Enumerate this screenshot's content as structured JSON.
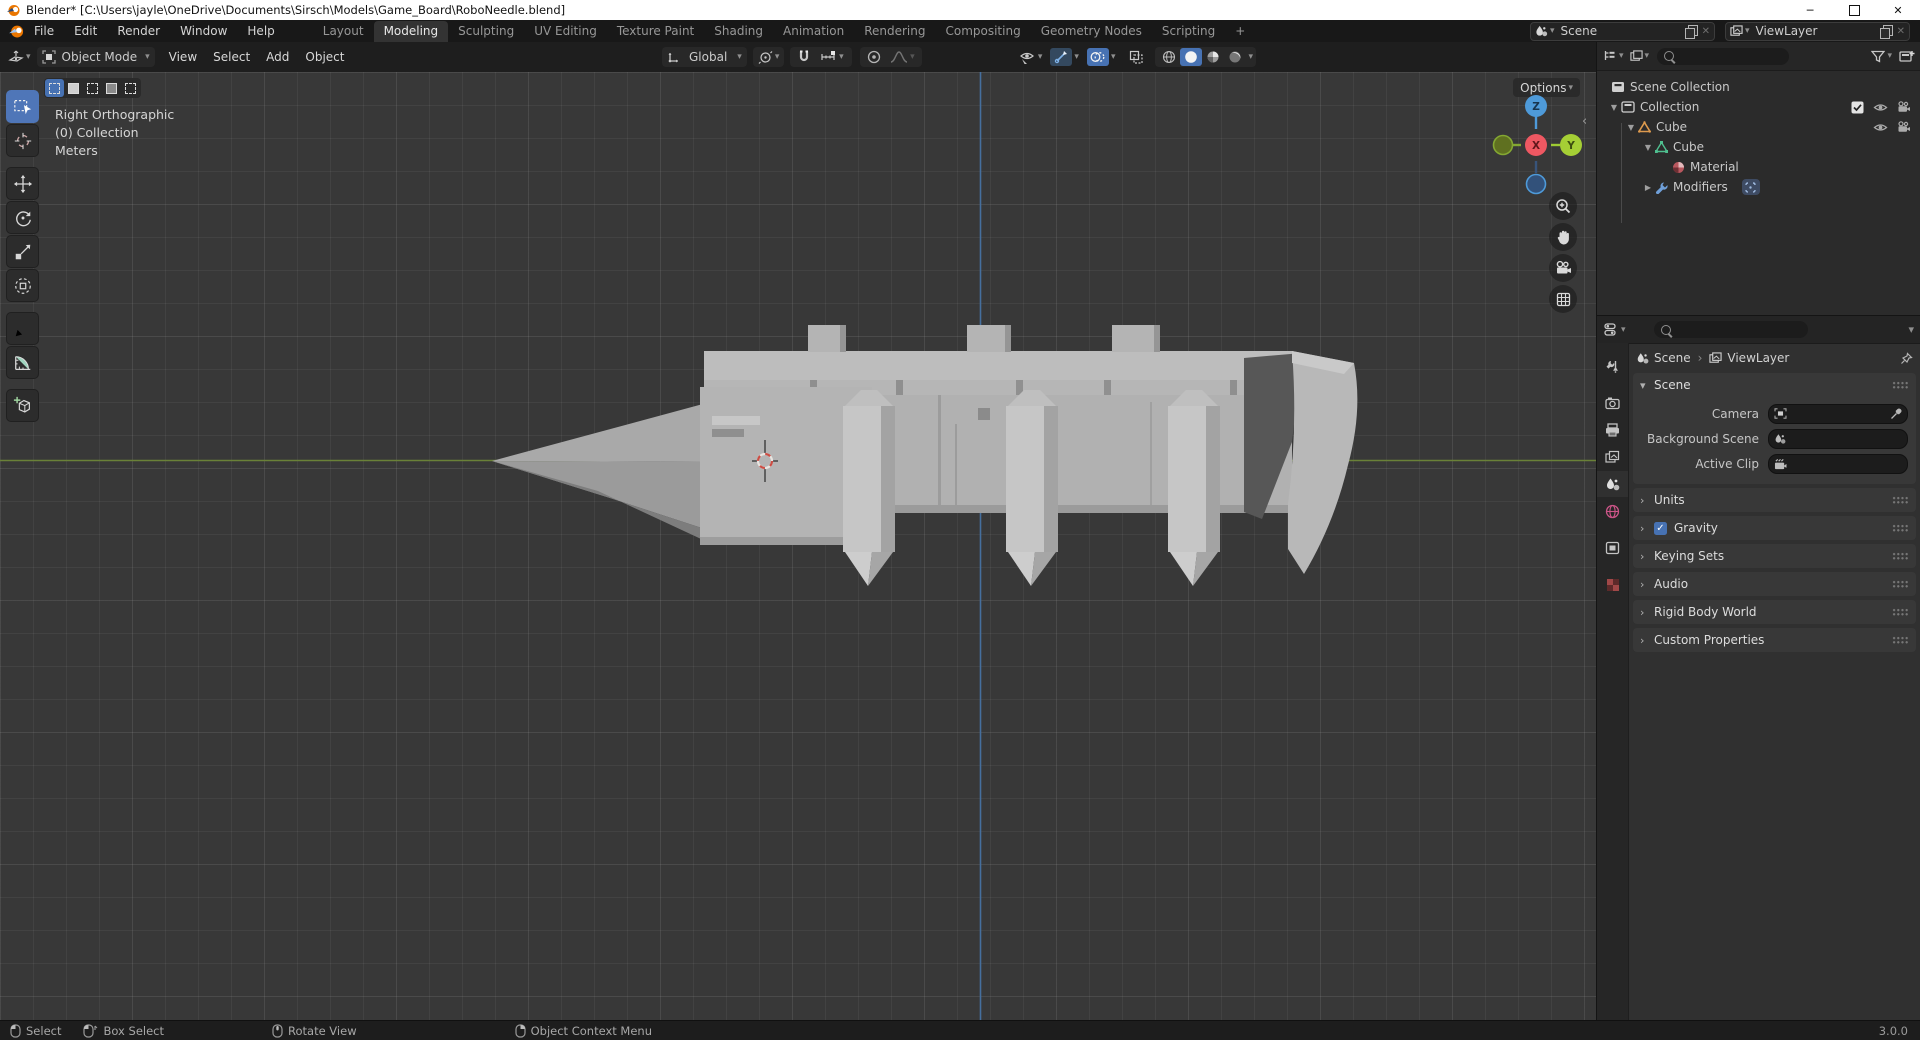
{
  "title_bar": {
    "title": "Blender* [C:\\Users\\jayle\\OneDrive\\Documents\\Sirsch\\Models\\Game_Board\\RoboNeedle.blend]"
  },
  "topbar": {
    "menus": {
      "file": "File",
      "edit": "Edit",
      "render": "Render",
      "window": "Window",
      "help": "Help"
    },
    "tabs": [
      "Layout",
      "Modeling",
      "Sculpting",
      "UV Editing",
      "Texture Paint",
      "Shading",
      "Animation",
      "Rendering",
      "Compositing",
      "Geometry Nodes",
      "Scripting"
    ],
    "active_tab": "Modeling",
    "add_tab": "+",
    "scene": "Scene",
    "view_layer": "ViewLayer"
  },
  "tool_header": {
    "mode": "Object Mode",
    "view": "View",
    "select": "Select",
    "add": "Add",
    "object": "Object",
    "orientation": "Global",
    "options": "Options"
  },
  "viewport": {
    "view_label": "Right Orthographic",
    "collection_label": "(0) Collection",
    "units_label": "Meters",
    "axis_x": "X",
    "axis_y": "Y",
    "axis_z": "Z"
  },
  "toolbar": {
    "tools": [
      "select-box",
      "cursor",
      "move",
      "rotate",
      "scale",
      "transform",
      "annotate",
      "measure",
      "add-cube"
    ],
    "active_tool": "select-box"
  },
  "outliner": {
    "scene_collection": "Scene Collection",
    "collection": "Collection",
    "object": "Cube",
    "mesh": "Cube",
    "material": "Material",
    "modifiers": "Modifiers"
  },
  "properties": {
    "breadcrumb_scene": "Scene",
    "breadcrumb_viewlayer": "ViewLayer",
    "scene_panel_title": "Scene",
    "camera_label": "Camera",
    "background_scene_label": "Background Scene",
    "active_clip_label": "Active Clip",
    "panels": [
      "Units",
      "Gravity",
      "Keying Sets",
      "Audio",
      "Rigid Body World",
      "Custom Properties"
    ],
    "gravity_checked": "✓"
  },
  "status_bar": {
    "select": "Select",
    "box_select": "Box Select",
    "rotate_view": "Rotate View",
    "context_menu": "Object Context Menu",
    "version": "3.0.0"
  },
  "colors": {
    "accent": "#4772b3",
    "axis_x": "#e5584f",
    "axis_y": "#84a832",
    "axis_z": "#4e9ad9"
  }
}
